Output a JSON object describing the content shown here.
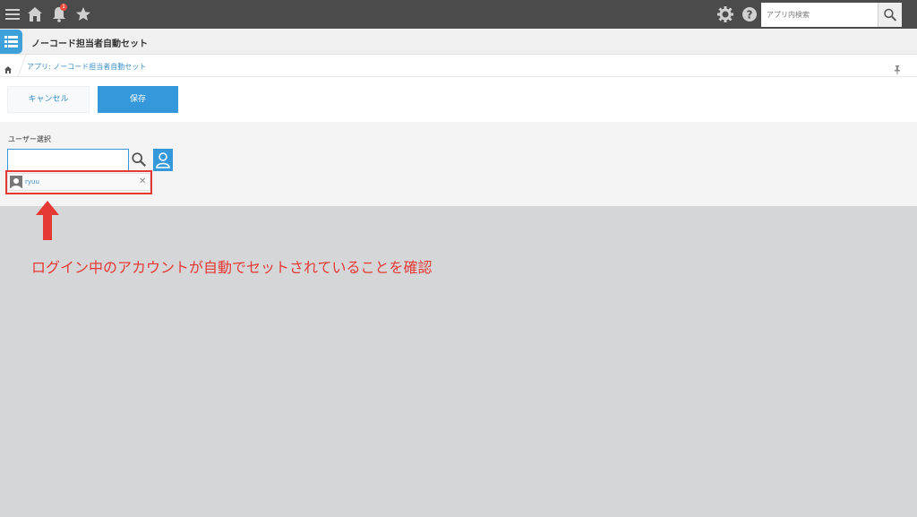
{
  "header": {
    "icons": [
      "menu-icon",
      "home-icon",
      "bell-icon",
      "star-icon",
      "gear-icon",
      "help-icon"
    ],
    "notification_count": "1",
    "search_placeholder": "アプリ内検索"
  },
  "app": {
    "name": "ノーコード担当者自動セット",
    "breadcrumb": "アプリ: ノーコード担当者自動セット"
  },
  "actions": {
    "cancel_label": "キャンセル",
    "save_label": "保存"
  },
  "form": {
    "user_field_label": "ユーザー選択",
    "selected_users": [
      {
        "name": "ryuu"
      }
    ]
  },
  "annotation": {
    "text": "ログイン中のアカウントが自動でセットされていることを確認"
  },
  "colors": {
    "header_bg": "#4b4b4b",
    "accent": "#3498db",
    "annotation": "#e53935",
    "page_bg": "#d5d6d8"
  }
}
